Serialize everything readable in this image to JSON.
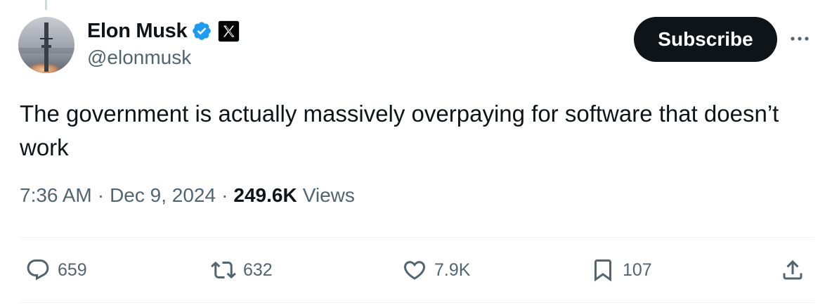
{
  "tweet": {
    "author": {
      "name": "Elon Musk",
      "handle": "@elonmusk",
      "verified_color": "#1d9bf0",
      "affiliation_badge": "x-logo-icon"
    },
    "subscribe_label": "Subscribe",
    "text": "The government is actually massively overpaying for software that doesn’t work",
    "time": "7:36 AM",
    "separator": "·",
    "date": "Dec 9, 2024",
    "views_count": "249.6K",
    "views_label": "Views",
    "actions": {
      "replies": "659",
      "reposts": "632",
      "likes": "7.9K",
      "bookmarks": "107"
    }
  },
  "colors": {
    "text_primary": "#0f1419",
    "text_secondary": "#536471",
    "button_bg": "#0f1419",
    "divider": "#eff3f4"
  }
}
